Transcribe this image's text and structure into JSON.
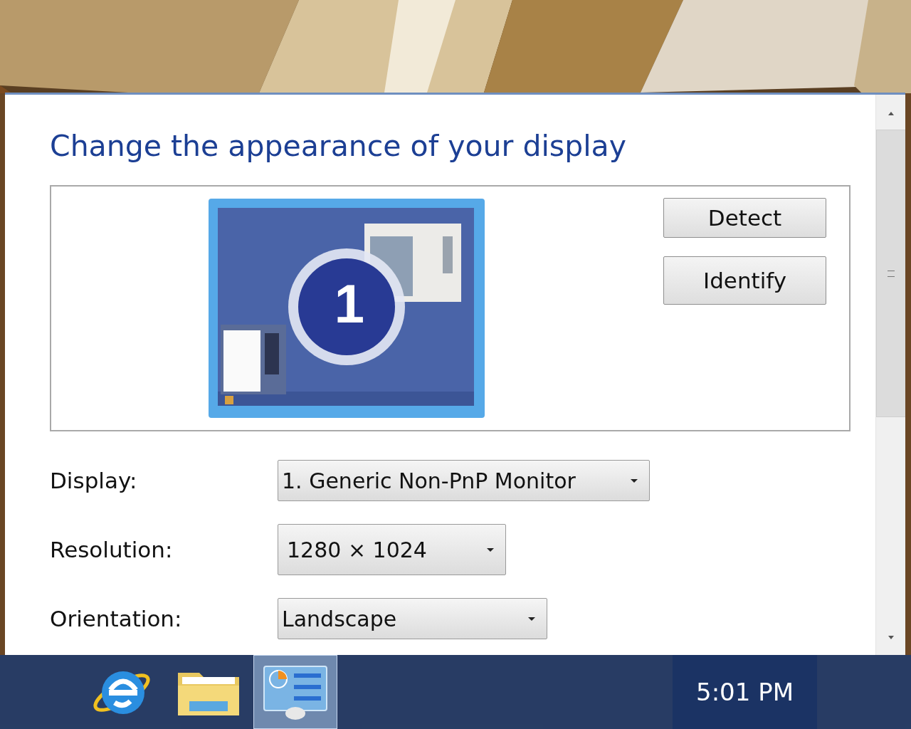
{
  "window": {
    "heading": "Change the appearance of your display"
  },
  "preview": {
    "display_number": "1",
    "buttons": [
      "Detect",
      "Identify"
    ]
  },
  "settings": [
    {
      "label": "Display:",
      "value": "1. Generic Non-PnP Monitor"
    },
    {
      "label": "Resolution:",
      "value": "1280 × 1024"
    },
    {
      "label": "Orientation:",
      "value": "Landscape"
    }
  ],
  "taskbar": {
    "items": [
      {
        "kind": "browser",
        "selected": false
      },
      {
        "kind": "folder",
        "selected": false
      },
      {
        "kind": "control-panel",
        "selected": true
      }
    ],
    "clock": "5:01 PM"
  }
}
